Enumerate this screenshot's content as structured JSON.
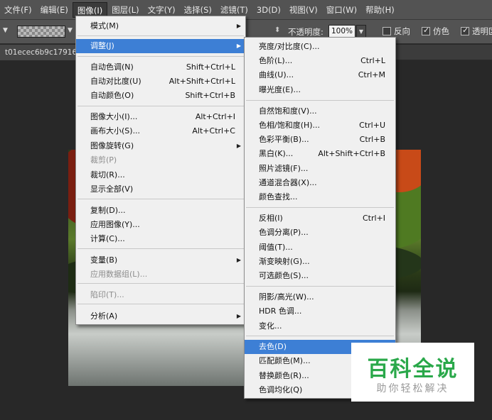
{
  "menubar": {
    "items": [
      "文件(F)",
      "编辑(E)",
      "图像(I)",
      "图层(L)",
      "文字(Y)",
      "选择(S)",
      "滤镜(T)",
      "3D(D)",
      "视图(V)",
      "窗口(W)",
      "帮助(H)"
    ]
  },
  "options": {
    "opacity_label": "不透明度:",
    "opacity_value": "100%",
    "reverse_label": "反向",
    "dither_label": "仿色",
    "transparency_label": "透明区"
  },
  "doc_tab": "t01ecec6b9c17916",
  "image_menu": [
    {
      "label": "模式(M)",
      "submenu": true
    },
    {
      "separator": true
    },
    {
      "label": "调整(J)",
      "submenu": true,
      "highlight": true
    },
    {
      "separator": true
    },
    {
      "label": "自动色调(N)",
      "shortcut": "Shift+Ctrl+L"
    },
    {
      "label": "自动对比度(U)",
      "shortcut": "Alt+Shift+Ctrl+L"
    },
    {
      "label": "自动颜色(O)",
      "shortcut": "Shift+Ctrl+B"
    },
    {
      "separator": true
    },
    {
      "label": "图像大小(I)...",
      "shortcut": "Alt+Ctrl+I"
    },
    {
      "label": "画布大小(S)...",
      "shortcut": "Alt+Ctrl+C"
    },
    {
      "label": "图像旋转(G)",
      "submenu": true
    },
    {
      "label": "裁剪(P)",
      "disabled": true
    },
    {
      "label": "裁切(R)..."
    },
    {
      "label": "显示全部(V)"
    },
    {
      "separator": true
    },
    {
      "label": "复制(D)..."
    },
    {
      "label": "应用图像(Y)..."
    },
    {
      "label": "计算(C)..."
    },
    {
      "separator": true
    },
    {
      "label": "变量(B)",
      "submenu": true
    },
    {
      "label": "应用数据组(L)...",
      "disabled": true
    },
    {
      "separator": true
    },
    {
      "label": "陷印(T)...",
      "disabled": true
    },
    {
      "separator": true
    },
    {
      "label": "分析(A)",
      "submenu": true
    }
  ],
  "adjust_menu": [
    {
      "label": "亮度/对比度(C)..."
    },
    {
      "label": "色阶(L)...",
      "shortcut": "Ctrl+L"
    },
    {
      "label": "曲线(U)...",
      "shortcut": "Ctrl+M"
    },
    {
      "label": "曝光度(E)..."
    },
    {
      "separator": true
    },
    {
      "label": "自然饱和度(V)..."
    },
    {
      "label": "色相/饱和度(H)...",
      "shortcut": "Ctrl+U"
    },
    {
      "label": "色彩平衡(B)...",
      "shortcut": "Ctrl+B"
    },
    {
      "label": "黑白(K)...",
      "shortcut": "Alt+Shift+Ctrl+B"
    },
    {
      "label": "照片滤镜(F)..."
    },
    {
      "label": "通道混合器(X)..."
    },
    {
      "label": "颜色查找..."
    },
    {
      "separator": true
    },
    {
      "label": "反相(I)",
      "shortcut": "Ctrl+I"
    },
    {
      "label": "色调分离(P)..."
    },
    {
      "label": "阈值(T)..."
    },
    {
      "label": "渐变映射(G)..."
    },
    {
      "label": "可选颜色(S)..."
    },
    {
      "separator": true
    },
    {
      "label": "阴影/高光(W)..."
    },
    {
      "label": "HDR 色调..."
    },
    {
      "label": "变化..."
    },
    {
      "separator": true
    },
    {
      "label": "去色(D)",
      "shortcut": "Shift",
      "highlight": true
    },
    {
      "label": "匹配颜色(M)..."
    },
    {
      "label": "替换颜色(R)..."
    },
    {
      "label": "色调均化(Q)"
    }
  ],
  "watermark": {
    "title": "百科全说",
    "subtitle": "助你轻松解决",
    "color": "#2aa84a"
  },
  "colors": {
    "highlight": "#3d7fd5",
    "menu_bg": "#f0f0f0",
    "chrome": "#535353"
  }
}
